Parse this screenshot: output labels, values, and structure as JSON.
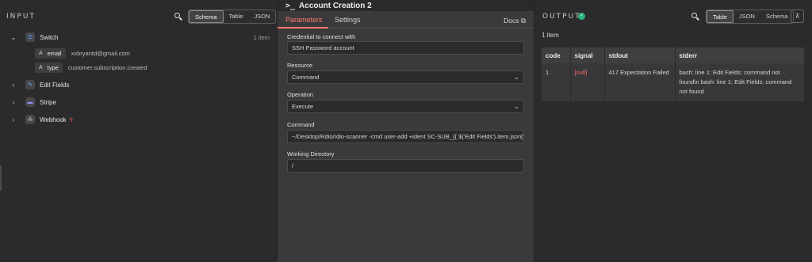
{
  "input": {
    "title": "INPUT",
    "view_options": [
      "Schema",
      "Table",
      "JSON"
    ],
    "active_view": "Schema",
    "nodes": [
      {
        "label": "Switch",
        "expanded": true,
        "item_count": "1 item",
        "icon": "switch-icon"
      },
      {
        "label": "Edit Fields",
        "expanded": false,
        "icon": "pencil-icon"
      },
      {
        "label": "Stripe",
        "expanded": false,
        "icon": "stripe-icon"
      },
      {
        "label": "Webhook",
        "expanded": false,
        "icon": "webhook-icon",
        "badge_icon": "bolt-icon"
      }
    ],
    "fields": [
      {
        "type_glyph": "A",
        "name": "email",
        "value": "xxbryantd@gmail.com"
      },
      {
        "type_glyph": "A",
        "name": "type",
        "value": "customer.subscription.created"
      }
    ]
  },
  "node": {
    "title": "Account Creation 2",
    "title_icon": ">_",
    "tabs": [
      "Parameters",
      "Settings"
    ],
    "active_tab": "Parameters",
    "docs_label": "Docs",
    "credential": {
      "label": "Credential to connect with",
      "value": "SSH Password account"
    },
    "resource": {
      "label": "Resource",
      "value": "Command"
    },
    "operation": {
      "label": "Operation",
      "value": "Execute"
    },
    "command": {
      "label": "Command",
      "value": "~/Desktop/Rdio/rdio-scanner -cmd user-add +ident SC-SUB_{{ $('Edit Fields').item.json[\"email\"]"
    },
    "working_directory": {
      "label": "Working Directory",
      "value": "/"
    }
  },
  "output": {
    "title": "OUTPUT",
    "status_color": "#2bb37a",
    "view_options": [
      "Table",
      "JSON",
      "Schema"
    ],
    "active_view": "Table",
    "items_count": "1 item",
    "columns": [
      "code",
      "signal",
      "stdout",
      "stderr"
    ],
    "rows": [
      {
        "code": "1",
        "signal": "[null]",
        "stdout": "417 Expectation Failed",
        "stderr": "bash: line 1: Edit Fields: command not found\\n bash: line 1: Edit Fields: command not found"
      }
    ]
  },
  "colors": {
    "accent": "#ff7a6b",
    "success": "#2bb37a",
    "null": "#ff6b6b"
  }
}
